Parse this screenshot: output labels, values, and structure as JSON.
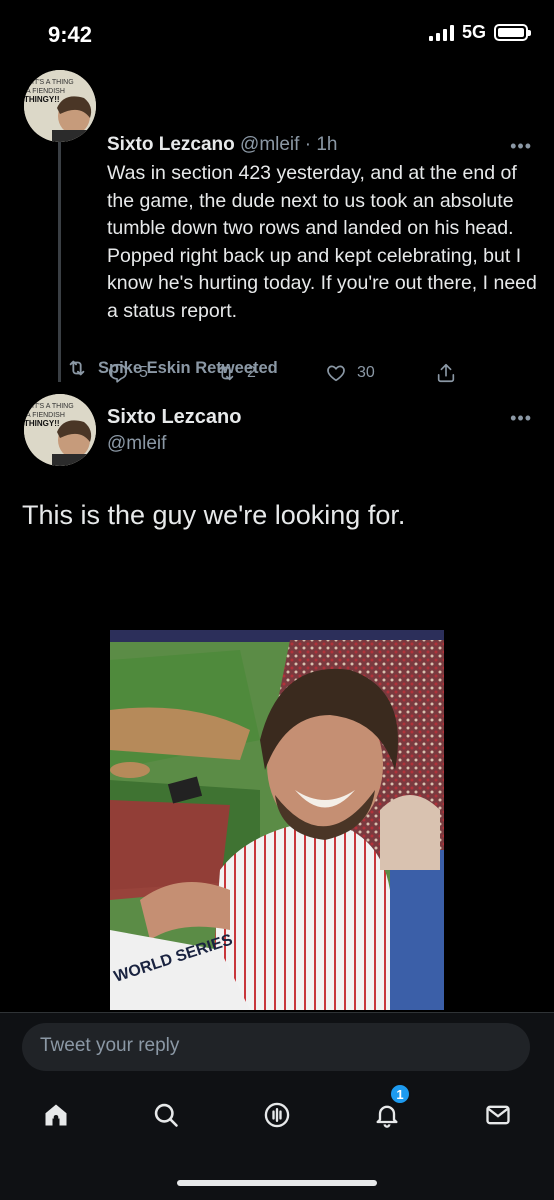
{
  "status_bar": {
    "time": "9:42",
    "network": "5G"
  },
  "tweet_1": {
    "name": "Sixto Lezcano",
    "handle": "@mleif",
    "time": "1h",
    "separator": " · ",
    "text": "Was in section 423 yesterday, and at the end of the game, the dude next to us took an absolute tumble down two rows and landed on his head. Popped right back up and kept celebrating, but I know he's hurting today. If you're out there, I need a status report.",
    "replies": "5",
    "retweets": "2",
    "likes": "30",
    "avatar_text": [
      "IT'S A THING",
      "A FIENDISH",
      "THINGY!!"
    ]
  },
  "retweet_banner": {
    "label": "Spike Eskin Retweeted"
  },
  "tweet_2": {
    "name": "Sixto Lezcano",
    "handle": "@mleif",
    "text": "This is the guy we're looking for.",
    "photo_caption": "WORLD SERIES"
  },
  "reply_bar": {
    "placeholder": "Tweet your reply"
  },
  "tabbar": {
    "notification_count": "1"
  },
  "colors": {
    "accent": "#1d9bf0",
    "background": "#000000",
    "muted": "#8b98a5"
  }
}
